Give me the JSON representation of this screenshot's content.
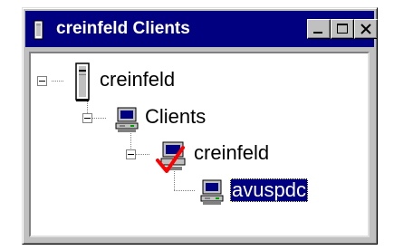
{
  "window": {
    "title": "creinfeld Clients",
    "icon": "server-tower-icon",
    "titlebar_color": "#000080",
    "buttons": [
      "minimize",
      "maximize",
      "close"
    ]
  },
  "tree": {
    "nodes": [
      {
        "label": "creinfeld",
        "icon": "server-tower-icon",
        "expanded": true,
        "selected": false
      },
      {
        "label": "Clients",
        "icon": "computer-group-icon",
        "expanded": true,
        "selected": false
      },
      {
        "label": "creinfeld",
        "icon": "computer-checkmark-icon",
        "expanded": true,
        "selected": false
      },
      {
        "label": "avuspdc",
        "icon": "computer-icon",
        "expanded": false,
        "selected": true
      }
    ],
    "selection_color": "#000080"
  }
}
